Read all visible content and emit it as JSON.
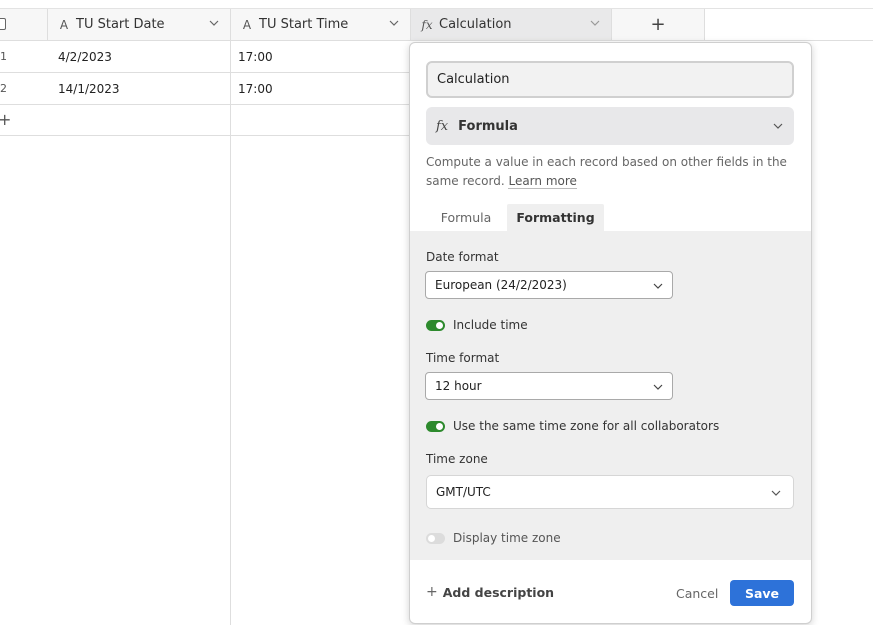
{
  "grid": {
    "columns": [
      {
        "name": "TU Start Date",
        "type_icon": "text-type-icon"
      },
      {
        "name": "TU Start Time",
        "type_icon": "text-type-icon"
      },
      {
        "name": "Calculation",
        "type_icon": "formula-fx-icon"
      }
    ],
    "add_column_label": "+",
    "rows": [
      {
        "num": "1",
        "start_date": "4/2/2023",
        "start_time": "17:00"
      },
      {
        "num": "2",
        "start_date": "14/1/2023",
        "start_time": "17:00"
      }
    ],
    "add_row_label": "+"
  },
  "panel": {
    "field_name_value": "Calculation",
    "field_type": {
      "icon": "fx",
      "label": "Formula"
    },
    "description_text": "Compute a value in each record based on other fields in the same record.",
    "learn_more": "Learn more",
    "tabs": [
      {
        "label": "Formula",
        "active": false
      },
      {
        "label": "Formatting",
        "active": true
      }
    ],
    "formatting": {
      "date_format_label": "Date format",
      "date_format_value": "European (24/2/2023)",
      "include_time_label": "Include time",
      "include_time": true,
      "time_format_label": "Time format",
      "time_format_value": "12 hour",
      "same_tz_label": "Use the same time zone for all collaborators",
      "same_tz": true,
      "time_zone_label": "Time zone",
      "time_zone_value": "GMT/UTC",
      "display_tz_label": "Display time zone",
      "display_tz": false
    },
    "footer": {
      "add_description": "Add description",
      "cancel": "Cancel",
      "save": "Save"
    }
  },
  "colors": {
    "accent": "#2d72d9",
    "toggle_on": "#2d8a2d"
  }
}
